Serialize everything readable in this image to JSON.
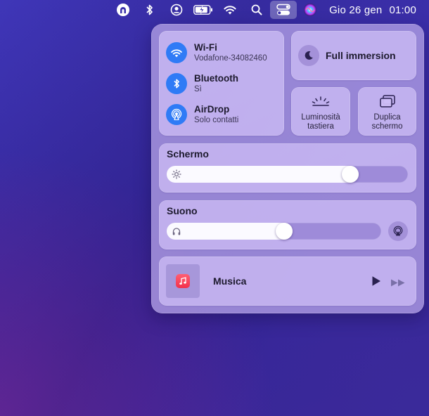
{
  "menubar": {
    "icons": [
      "tunnel-icon",
      "bluetooth-icon",
      "user-icon",
      "battery-charging-icon",
      "wifi-icon",
      "search-icon",
      "control-center-icon",
      "siri-icon"
    ],
    "date": "Gio 26 gen",
    "time": "01:00"
  },
  "control_center": {
    "network": {
      "wifi": {
        "title": "Wi-Fi",
        "subtitle": "Vodafone-34082460"
      },
      "bluetooth": {
        "title": "Bluetooth",
        "subtitle": "Sì"
      },
      "airdrop": {
        "title": "AirDrop",
        "subtitle": "Solo contatti"
      }
    },
    "focus": {
      "label": "Full immersion"
    },
    "keyboard_brightness": {
      "label_line1": "Luminosità",
      "label_line2": "tastiera"
    },
    "screen_mirroring": {
      "label_line1": "Duplica",
      "label_line2": "schermo"
    },
    "display": {
      "title": "Schermo",
      "level": 0.78
    },
    "sound": {
      "title": "Suono",
      "level": 0.55
    },
    "music": {
      "title": "Musica"
    }
  },
  "colors": {
    "accent": "#2f7bf6",
    "music_app": "#f2314c"
  }
}
